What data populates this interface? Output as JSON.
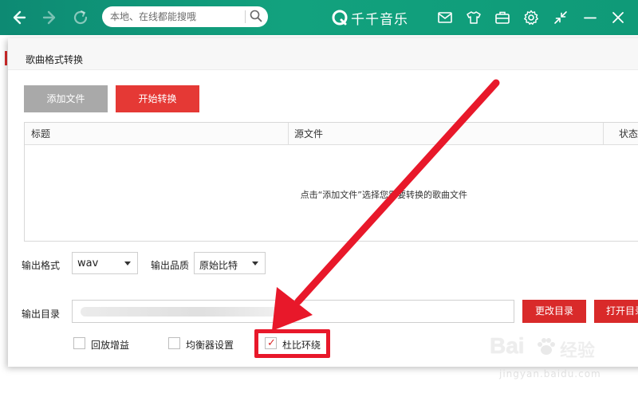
{
  "topbar": {
    "search_placeholder": "本地、在线都能搜哦",
    "brand_name": "千千音乐",
    "icons": [
      "back-icon",
      "forward-icon",
      "refresh-icon",
      "search-icon",
      "mail-icon",
      "skin-icon",
      "toolbox-icon",
      "settings-icon",
      "mini-mode-icon",
      "minimize-icon",
      "close-icon"
    ]
  },
  "dialog": {
    "title": "歌曲格式转换",
    "add_file_button": "添加文件",
    "start_convert_button": "开始转换",
    "table": {
      "columns": [
        "标题",
        "源文件",
        "状态"
      ],
      "empty_hint": "点击“添加文件”选择您需要转换的歌曲文件"
    },
    "output_format": {
      "label": "输出格式",
      "value": "wav"
    },
    "output_quality": {
      "label": "输出品质",
      "value": "原始比特"
    },
    "output_dir": {
      "label": "输出目录",
      "value": "",
      "change_button": "更改目录",
      "open_button": "打开目录"
    },
    "options": [
      {
        "label": "回放增益",
        "checked": false
      },
      {
        "label": "均衡器设置",
        "checked": false
      },
      {
        "label": "杜比环绕",
        "checked": true
      }
    ]
  },
  "watermark": {
    "logo": "Bai",
    "brand_cn": "经验",
    "url": "jingyan.baidu.com"
  },
  "colors": {
    "topbar": "#12a27e",
    "accent_red": "#e53935",
    "annotation_red": "#e8182a",
    "disabled_gray": "#a9a9a9"
  }
}
